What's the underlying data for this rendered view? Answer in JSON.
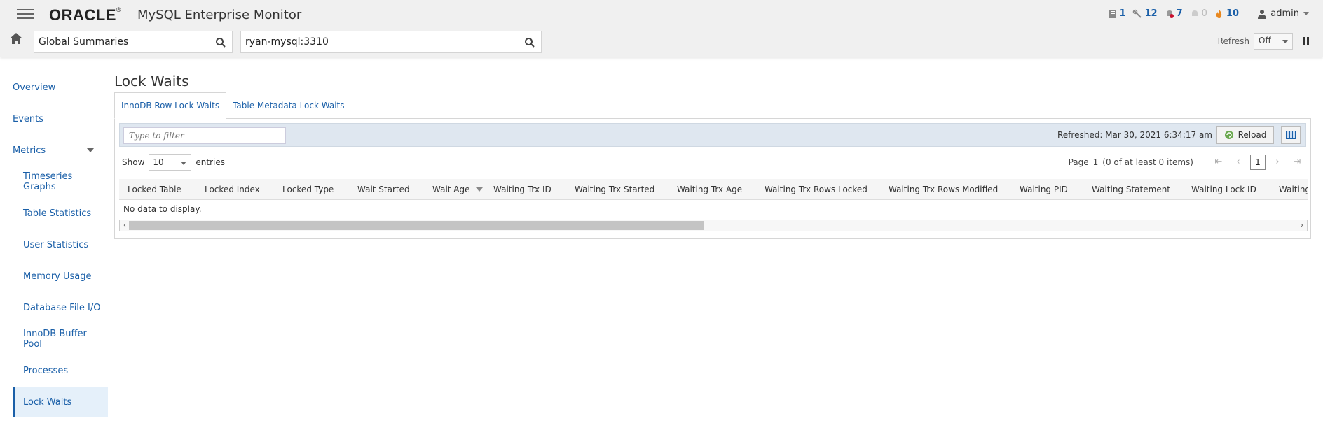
{
  "header": {
    "logo": "ORACLE",
    "logo_reg": "®",
    "product": "MySQL Enterprise Monitor",
    "status": [
      {
        "icon": "server-icon",
        "count": "1"
      },
      {
        "icon": "query-icon",
        "count": "12"
      },
      {
        "icon": "alert-bell-icon",
        "count": "7"
      },
      {
        "icon": "muted-bell-icon",
        "count": "0"
      },
      {
        "icon": "fire-icon",
        "count": "10"
      }
    ],
    "user": "admin"
  },
  "search": {
    "group_value": "Global Summaries",
    "instance_value": "ryan-mysql:3310"
  },
  "refresh": {
    "label": "Refresh",
    "value": "Off"
  },
  "sidebar": {
    "items": [
      {
        "label": "Overview"
      },
      {
        "label": "Events"
      },
      {
        "label": "Metrics"
      },
      {
        "label": "Timeseries Graphs"
      },
      {
        "label": "Table Statistics"
      },
      {
        "label": "User Statistics"
      },
      {
        "label": "Memory Usage"
      },
      {
        "label": "Database File I/O"
      },
      {
        "label": "InnoDB Buffer Pool"
      },
      {
        "label": "Processes"
      },
      {
        "label": "Lock Waits"
      }
    ],
    "active": "Lock Waits"
  },
  "main": {
    "title": "Lock Waits",
    "tabs": [
      {
        "label": "InnoDB Row Lock Waits",
        "active": true
      },
      {
        "label": "Table Metadata Lock Waits",
        "active": false
      }
    ],
    "filter_placeholder": "Type to filter",
    "refreshed": "Refreshed: Mar 30, 2021 6:34:17 am",
    "reload_label": "Reload",
    "show_label": "Show",
    "entries_value": "10",
    "entries_label": "entries",
    "page_label": "Page",
    "page_number": "1",
    "page_info": "(0 of at least 0 items)",
    "page_current": "1",
    "columns": [
      "Locked Table",
      "Locked Index",
      "Locked Type",
      "Wait Started",
      "Wait Age",
      "Waiting Trx ID",
      "Waiting Trx Started",
      "Waiting Trx Age",
      "Waiting Trx Rows Locked",
      "Waiting Trx Rows Modified",
      "Waiting PID",
      "Waiting Statement",
      "Waiting Lock ID",
      "Waiting"
    ],
    "sorted_column": "Wait Age",
    "no_data": "No data to display."
  },
  "colors": {
    "link": "#1a5fa8",
    "toolbar": "#dfe7f0",
    "active_nav": "#e5f0fa"
  }
}
